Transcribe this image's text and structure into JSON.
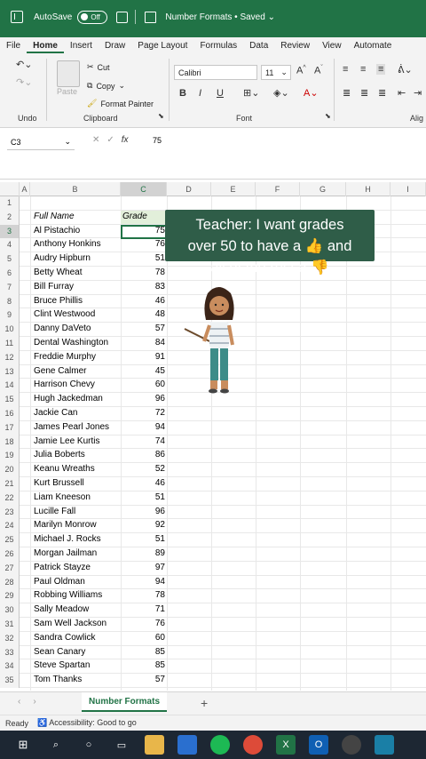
{
  "titlebar": {
    "autosave_label": "AutoSave",
    "autosave_state": "Off",
    "document_title": "Number Formats • Saved ⌄"
  },
  "ribbon_tabs": [
    "File",
    "Home",
    "Insert",
    "Draw",
    "Page Layout",
    "Formulas",
    "Data",
    "Review",
    "View",
    "Automate"
  ],
  "active_tab": "Home",
  "ribbon": {
    "undo_group": "Undo",
    "clipboard_group": "Clipboard",
    "font_group": "Font",
    "align_group": "Alig",
    "paste": "Paste",
    "cut": "Cut",
    "copy": "Copy",
    "format_painter": "Format Painter",
    "font_name": "Calibri",
    "font_size": "11",
    "bold": "B",
    "italic": "I",
    "underline": "U"
  },
  "formula_bar": {
    "name_box": "C3",
    "fx": "fx",
    "value": "75"
  },
  "columns": [
    "A",
    "B",
    "C",
    "D",
    "E",
    "F",
    "G",
    "H",
    "I"
  ],
  "header_row": {
    "row": "2",
    "name": "Full Name",
    "grade": "Grade"
  },
  "rows": [
    {
      "n": "1",
      "name": "",
      "grade": ""
    },
    {
      "n": "3",
      "name": "Al Pistachio",
      "grade": "75"
    },
    {
      "n": "4",
      "name": "Anthony Honkins",
      "grade": "76"
    },
    {
      "n": "5",
      "name": "Audry Hipburn",
      "grade": "51"
    },
    {
      "n": "6",
      "name": "Betty Wheat",
      "grade": "78"
    },
    {
      "n": "7",
      "name": "Bill Furray",
      "grade": "83"
    },
    {
      "n": "8",
      "name": "Bruce Phillis",
      "grade": "46"
    },
    {
      "n": "9",
      "name": "Clint Westwood",
      "grade": "48"
    },
    {
      "n": "10",
      "name": "Danny DaVeto",
      "grade": "57"
    },
    {
      "n": "11",
      "name": "Dental Washington",
      "grade": "84"
    },
    {
      "n": "12",
      "name": "Freddie Murphy",
      "grade": "91"
    },
    {
      "n": "13",
      "name": "Gene Calmer",
      "grade": "45"
    },
    {
      "n": "14",
      "name": "Harrison Chevy",
      "grade": "60"
    },
    {
      "n": "15",
      "name": "Hugh Jackedman",
      "grade": "96"
    },
    {
      "n": "16",
      "name": "Jackie Can",
      "grade": "72"
    },
    {
      "n": "17",
      "name": "James Pearl Jones",
      "grade": "94"
    },
    {
      "n": "18",
      "name": "Jamie Lee Kurtis",
      "grade": "74"
    },
    {
      "n": "19",
      "name": "Julia Boberts",
      "grade": "86"
    },
    {
      "n": "20",
      "name": "Keanu Wreaths",
      "grade": "52"
    },
    {
      "n": "21",
      "name": "Kurt Brussell",
      "grade": "46"
    },
    {
      "n": "22",
      "name": "Liam Kneeson",
      "grade": "51"
    },
    {
      "n": "23",
      "name": "Lucille Fall",
      "grade": "96"
    },
    {
      "n": "24",
      "name": "Marilyn Monrow",
      "grade": "92"
    },
    {
      "n": "25",
      "name": "Michael J. Rocks",
      "grade": "51"
    },
    {
      "n": "26",
      "name": "Morgan Jailman",
      "grade": "89"
    },
    {
      "n": "27",
      "name": "Patrick Stayze",
      "grade": "97"
    },
    {
      "n": "28",
      "name": "Paul Oldman",
      "grade": "94"
    },
    {
      "n": "29",
      "name": "Robbing Williams",
      "grade": "78"
    },
    {
      "n": "30",
      "name": "Sally Meadow",
      "grade": "71"
    },
    {
      "n": "31",
      "name": "Sam Well Jackson",
      "grade": "76"
    },
    {
      "n": "32",
      "name": "Sandra Cowlick",
      "grade": "60"
    },
    {
      "n": "33",
      "name": "Sean Canary",
      "grade": "85"
    },
    {
      "n": "34",
      "name": "Steve Spartan",
      "grade": "85"
    },
    {
      "n": "35",
      "name": "Tom Thanks",
      "grade": "57"
    }
  ],
  "caption": {
    "line1": "Teacher: I want grades",
    "line2": "over 50 to have a 👍 and",
    "line3": "all of the rest a 👎"
  },
  "sheet_tab": "Number Formats",
  "status": {
    "ready": "Ready",
    "accessibility": "Accessibility: Good to go"
  },
  "colors": {
    "accent": "#217346",
    "caption_bg": "#2f5d48"
  }
}
